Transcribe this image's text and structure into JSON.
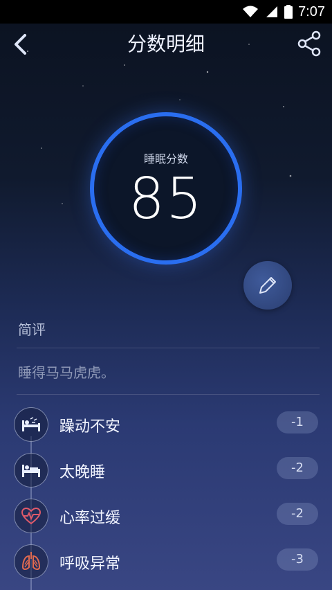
{
  "status": {
    "time": "7:07"
  },
  "header": {
    "title": "分数明细"
  },
  "score": {
    "label": "睡眠分数",
    "value": "85"
  },
  "review": {
    "section_title": "简评",
    "comment": "睡得马马虎虎。"
  },
  "deductions": [
    {
      "label": "躁动不安",
      "value": "-1",
      "icon": "restless-icon"
    },
    {
      "label": "太晚睡",
      "value": "-2",
      "icon": "late-sleep-icon"
    },
    {
      "label": "心率过缓",
      "value": "-2",
      "icon": "heart-rate-icon"
    },
    {
      "label": "呼吸异常",
      "value": "-3",
      "icon": "lungs-icon"
    }
  ],
  "colors": {
    "ring": "#2a6ef0",
    "heart": "#e05a6a",
    "lungs": "#e06a50"
  }
}
